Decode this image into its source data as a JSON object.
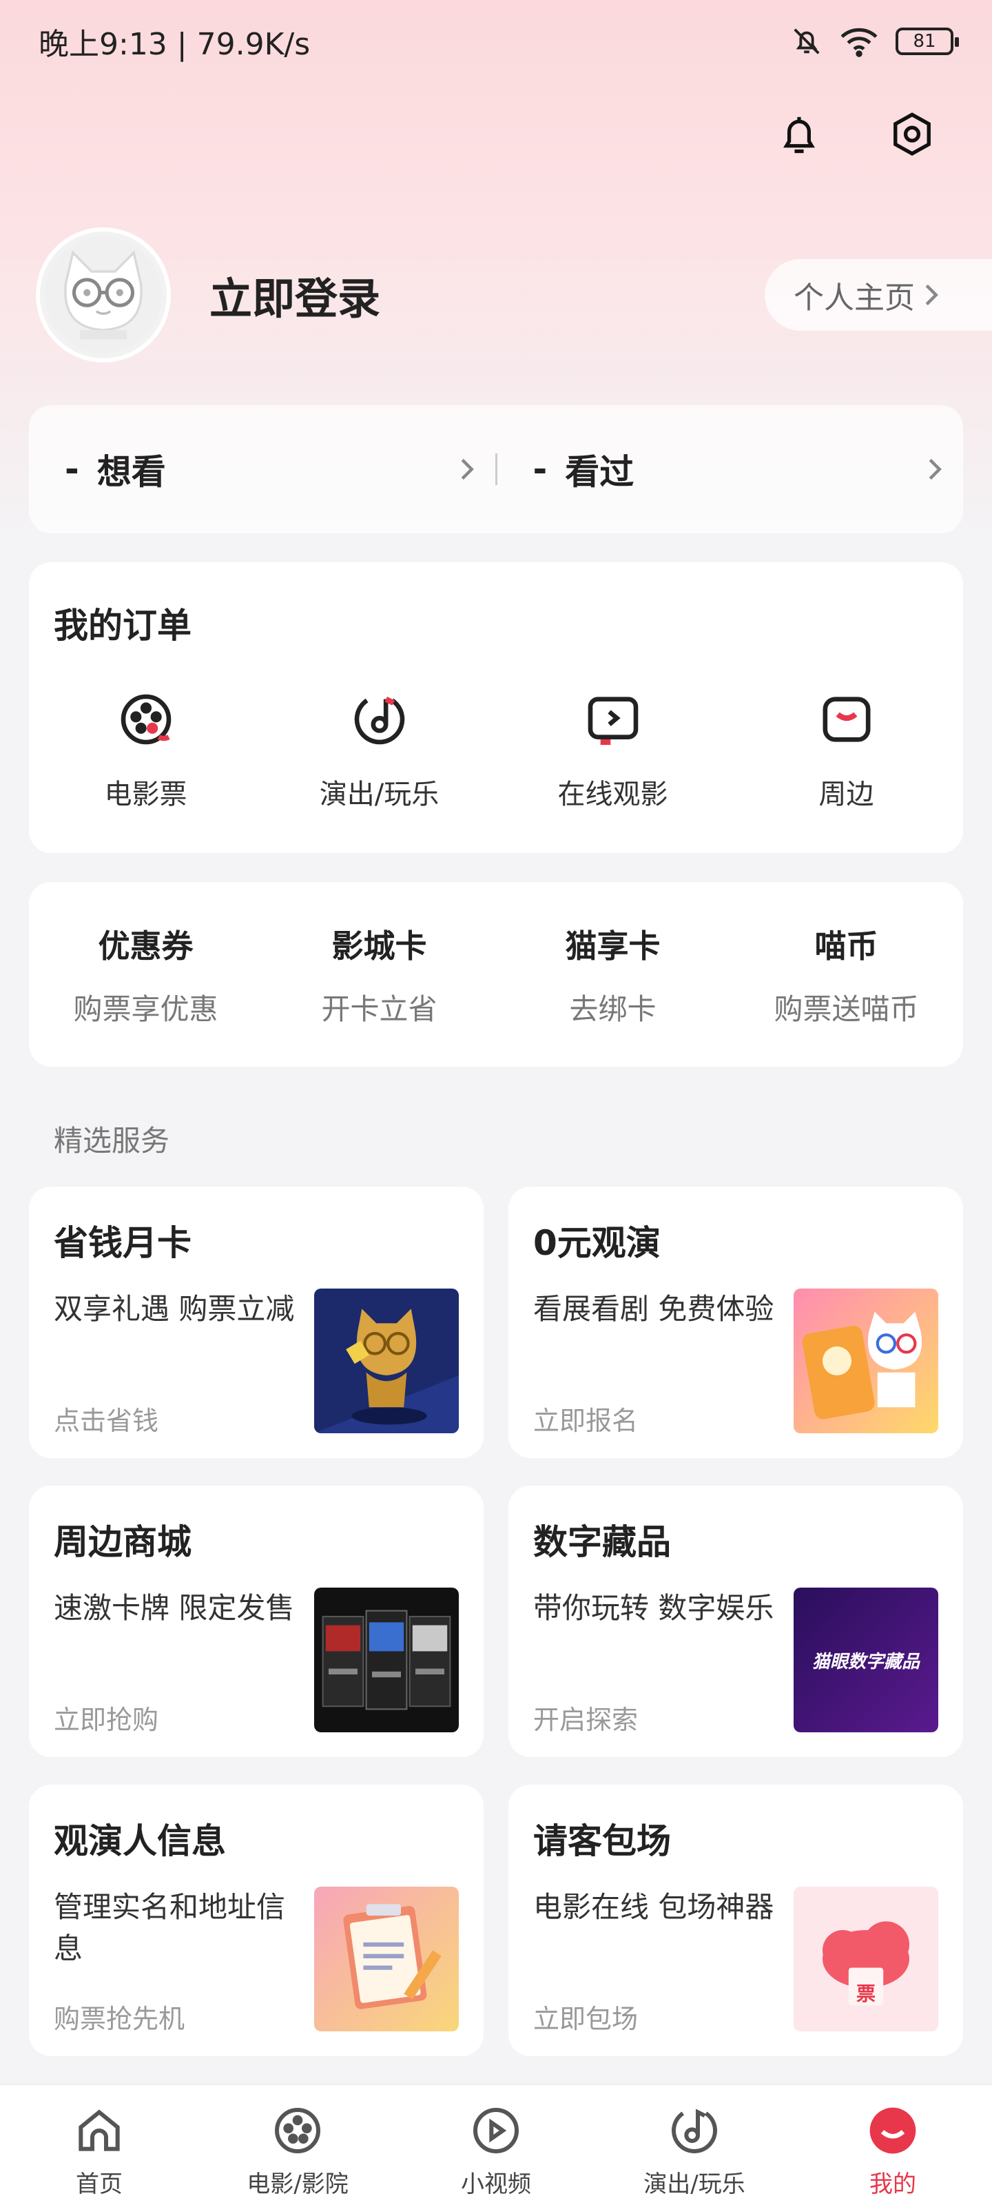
{
  "status_bar": {
    "time": "晚上9:13 | 79.9K/s",
    "battery": "81"
  },
  "profile": {
    "login_label": "立即登录",
    "homepage_label": "个人主页"
  },
  "watch": {
    "want": {
      "count": "-",
      "label": "想看"
    },
    "watched": {
      "count": "-",
      "label": "看过"
    }
  },
  "orders": {
    "title": "我的订单",
    "items": [
      {
        "label": "电影票",
        "icon": "film-reel-icon"
      },
      {
        "label": "演出/玩乐",
        "icon": "music-note-icon"
      },
      {
        "label": "在线观影",
        "icon": "play-screen-icon"
      },
      {
        "label": "周边",
        "icon": "merch-bag-icon"
      }
    ]
  },
  "benefits": [
    {
      "title": "优惠券",
      "sub": "购票享优惠"
    },
    {
      "title": "影城卡",
      "sub": "开卡立省"
    },
    {
      "title": "猫享卡",
      "sub": "去绑卡"
    },
    {
      "title": "喵币",
      "sub": "购票送喵币"
    }
  ],
  "services_label": "精选服务",
  "services": [
    {
      "title": "省钱月卡",
      "desc": "双享礼遇 购票立减",
      "action": "点击省钱"
    },
    {
      "title": "0元观演",
      "desc": "看展看剧 免费体验",
      "action": "立即报名"
    },
    {
      "title": "周边商城",
      "desc": "速激卡牌 限定发售",
      "action": "立即抢购"
    },
    {
      "title": "数字藏品",
      "desc": "带你玩转 数字娱乐",
      "action": "开启探索",
      "image_text": "猫眼数字藏品"
    },
    {
      "title": "观演人信息",
      "desc": "管理实名和地址信息",
      "action": "购票抢先机"
    },
    {
      "title": "请客包场",
      "desc": "电影在线 包场神器",
      "action": "立即包场",
      "image_text": "票"
    }
  ],
  "bottom_nav": [
    {
      "label": "首页"
    },
    {
      "label": "电影/影院"
    },
    {
      "label": "小视频"
    },
    {
      "label": "演出/玩乐"
    },
    {
      "label": "我的"
    }
  ],
  "colors": {
    "accent": "#e8374b",
    "header_pink": "#fbd9dc"
  }
}
